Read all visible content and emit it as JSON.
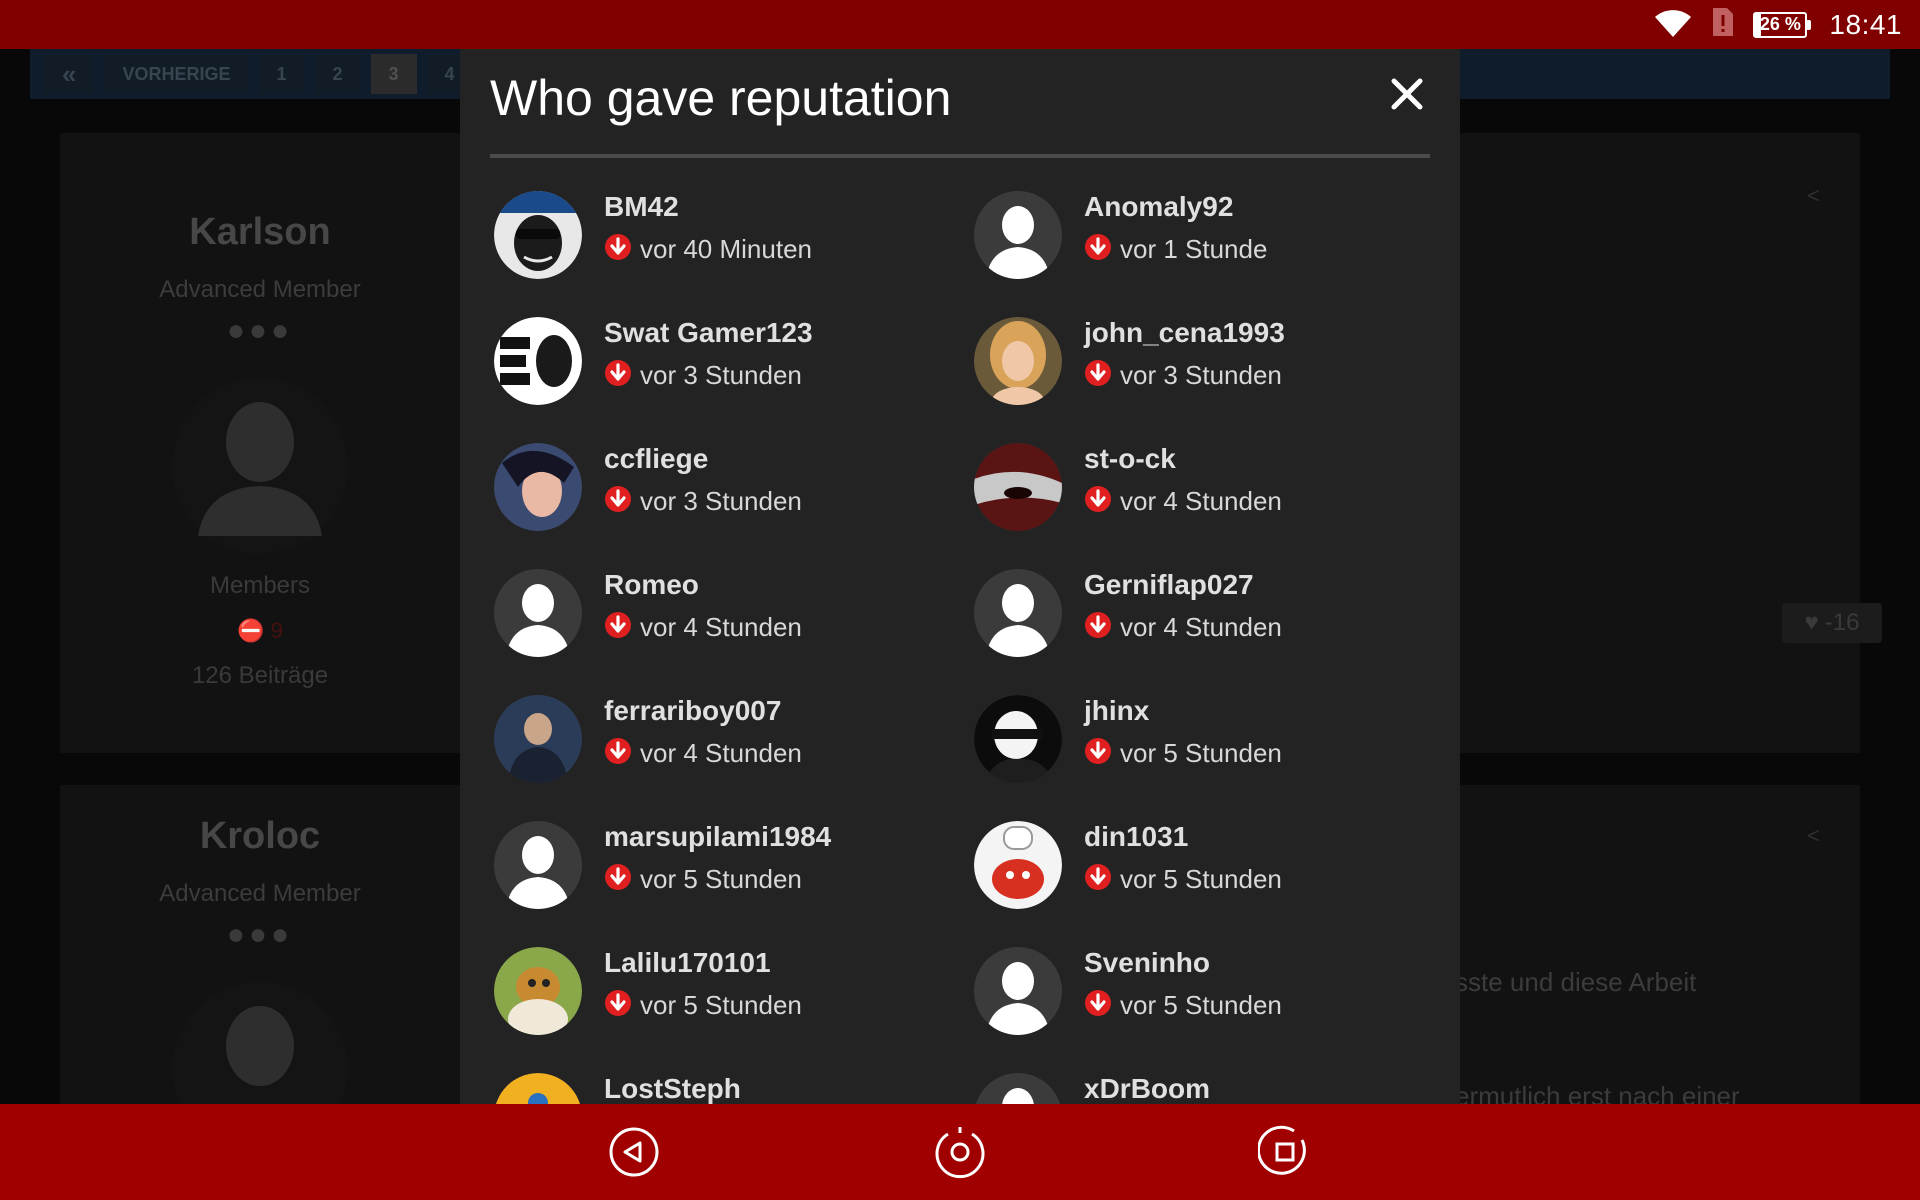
{
  "status_bar": {
    "battery": "26 %",
    "time": "18:41",
    "icons": [
      "wifi-icon",
      "sim-alert-icon",
      "battery-icon"
    ]
  },
  "background_page": {
    "pagination": {
      "first": "«",
      "prev": "VORHERIGE",
      "pages": [
        "1",
        "2",
        "3",
        "4"
      ],
      "active_page": "3"
    },
    "posts": [
      {
        "author": "Karlson",
        "rank": "Advanced Member",
        "group": "Members",
        "reputation": "9",
        "posts": "126 Beiträge",
        "like_count": "-16"
      },
      {
        "author": "Kroloc",
        "rank": "Advanced Member",
        "text_line_1": "sste und diese Arbeit",
        "text_line_2": "ermutlich erst nach einer"
      }
    ]
  },
  "modal": {
    "title": "Who gave reputation",
    "close_label": "✕",
    "entries": [
      {
        "name": "BM42",
        "time": "vor 40 Minuten",
        "avatar": "moderator-avatar"
      },
      {
        "name": "Anomaly92",
        "time": "vor 1 Stunde",
        "avatar": "default-avatar"
      },
      {
        "name": "Swat Gamer123",
        "time": "vor 3 Stunden",
        "avatar": "text-logo-avatar"
      },
      {
        "name": "john_cena1993",
        "time": "vor 3 Stunden",
        "avatar": "blonde-woman-avatar"
      },
      {
        "name": "ccfliege",
        "time": "vor 3 Stunden",
        "avatar": "game-girl-avatar"
      },
      {
        "name": "st-o-ck",
        "time": "vor 4 Stunden",
        "avatar": "red-eye-avatar"
      },
      {
        "name": "Romeo",
        "time": "vor 4 Stunden",
        "avatar": "default-avatar"
      },
      {
        "name": "Gerniflap027",
        "time": "vor 4 Stunden",
        "avatar": "default-avatar"
      },
      {
        "name": "ferrariboy007",
        "time": "vor 4 Stunden",
        "avatar": "game-hero-avatar"
      },
      {
        "name": "jhinx",
        "time": "vor 5 Stunden",
        "avatar": "masked-figure-avatar"
      },
      {
        "name": "marsupilami1984",
        "time": "vor 5 Stunden",
        "avatar": "default-avatar"
      },
      {
        "name": "din1031",
        "time": "vor 5 Stunden",
        "avatar": "cartoon-chef-avatar"
      },
      {
        "name": "Lalilu170101",
        "time": "vor 5 Stunden",
        "avatar": "cartoon-duck-avatar"
      },
      {
        "name": "Sveninho",
        "time": "vor 5 Stunden",
        "avatar": "default-avatar"
      },
      {
        "name": "LostSteph",
        "time": "",
        "avatar": "yellow-avatar"
      },
      {
        "name": "xDrBoom",
        "time": "",
        "avatar": "default-avatar"
      }
    ]
  },
  "nav_bar": {
    "icons": [
      "back-icon",
      "home-icon",
      "recents-icon"
    ]
  },
  "colors": {
    "status_bar": "#800000",
    "nav_bar": "#a00000",
    "modal_bg": "#232323",
    "downvote": "#e02020"
  }
}
